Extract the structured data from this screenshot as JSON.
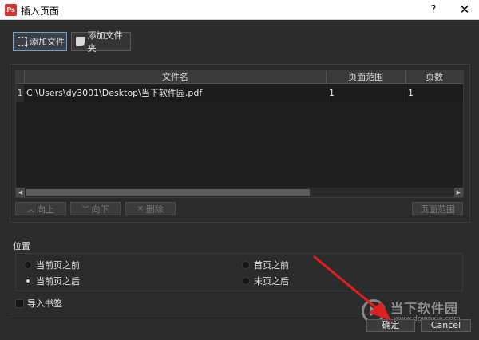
{
  "window": {
    "app_icon_text": "Ps",
    "title": "插入页面",
    "help_label": "?",
    "close_label": "✕"
  },
  "toolbar": {
    "add_file_label": "添加文件",
    "add_folder_label": "添加文件夹"
  },
  "file_table": {
    "headers": [
      "文件名",
      "页面范围",
      "页数"
    ],
    "rows": [
      {
        "index": "1",
        "file": "C:\\Users\\dy3001\\Desktop\\当下软件园.pdf",
        "range": "1",
        "pages": "1"
      }
    ]
  },
  "list_buttons": {
    "up_label": "向上",
    "down_label": "向下",
    "delete_label": "删除",
    "range_label": "页面范围"
  },
  "position": {
    "label": "位置",
    "options": [
      {
        "label": "当前页之前",
        "selected": false
      },
      {
        "label": "当前页之后",
        "selected": true
      },
      {
        "label": "首页之前",
        "selected": false
      },
      {
        "label": "末页之后",
        "selected": false
      }
    ]
  },
  "import_bookmarks": {
    "label": "导入书签",
    "checked": false
  },
  "dialog_buttons": {
    "ok_label": "确定",
    "cancel_label": "Cancel"
  },
  "watermark": {
    "name": "当下软件园",
    "url": "www.downxia.com"
  },
  "colors": {
    "accent_border": "#6fa3d8",
    "annotation_arrow": "#e02020",
    "app_icon": "#d9342b"
  }
}
